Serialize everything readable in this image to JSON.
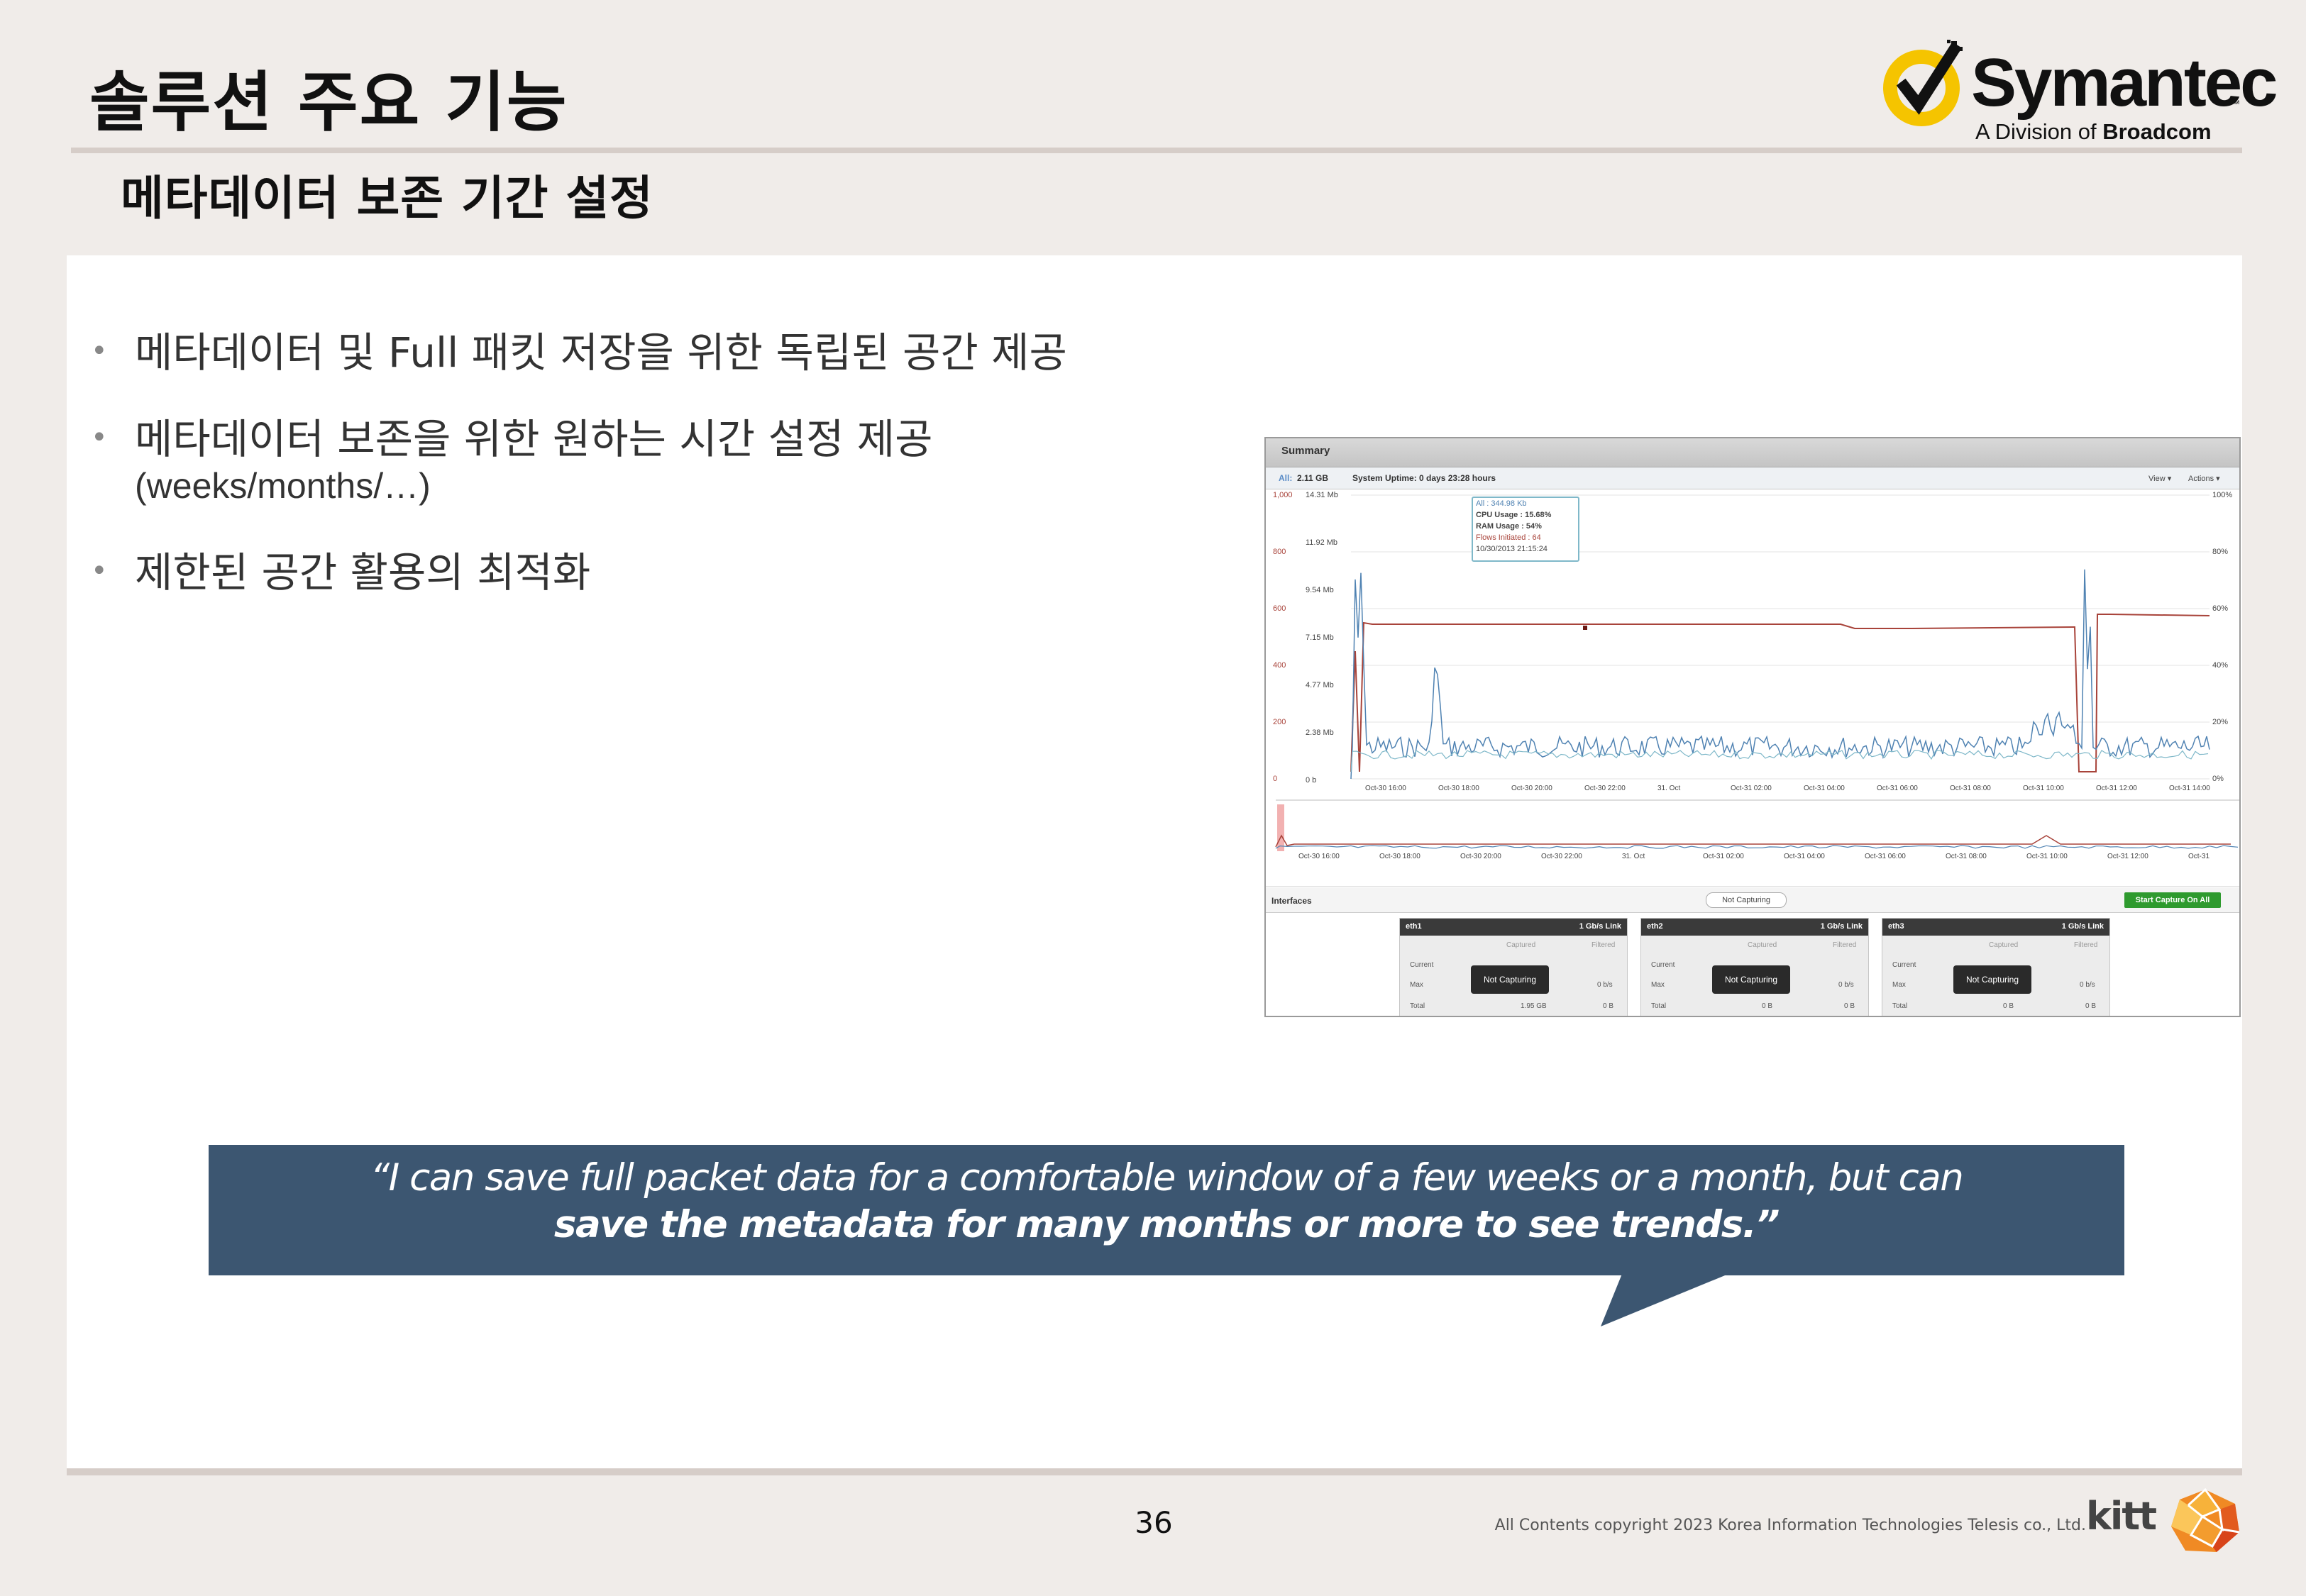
{
  "slide": {
    "title": "솔루션 주요 기능",
    "subtitle": "메타데이터 보존 기간 설정"
  },
  "logo": {
    "name": "Symantec",
    "tm": "™",
    "division_prefix": "A Division of ",
    "division_brand": "Broadcom",
    "colors": {
      "ring": "#f5c400",
      "check": "#111111"
    }
  },
  "bullets": [
    {
      "text": "메타데이터 및 Full 패킷 저장을 위한 독립된 공간 제공"
    },
    {
      "text": "메타데이터 보존을 위한 원하는 시간 설정 제공",
      "text2": "(weeks/months/…)"
    },
    {
      "text": "제한된 공간 활용의 최적화"
    }
  ],
  "screenshot": {
    "panel_title": "Summary",
    "all_label": "All:",
    "all_value": "2.11 GB",
    "uptime": "System Uptime: 0 days 23:28 hours",
    "view_menu": "View ▾",
    "actions_menu": "Actions ▾",
    "tooltip": {
      "all": "All : 344.98 Kb",
      "cpu": "CPU Usage : 15.68%",
      "ram": "RAM Usage : 54%",
      "flows": "Flows Initiated : 64",
      "time": "10/30/2013 21:15:24"
    },
    "left_axis_red": [
      "1,000",
      "800",
      "600",
      "400",
      "200",
      "0"
    ],
    "left_axis_blue": [
      "14.31 Mb",
      "11.92 Mb",
      "9.54 Mb",
      "7.15 Mb",
      "4.77 Mb",
      "2.38 Mb",
      "0 b"
    ],
    "right_axis": [
      "100%",
      "80%",
      "60%",
      "40%",
      "20%",
      "0%"
    ],
    "x_ticks": [
      "Oct-30 16:00",
      "Oct-30 18:00",
      "Oct-30 20:00",
      "Oct-30 22:00",
      "31. Oct",
      "Oct-31 02:00",
      "Oct-31 04:00",
      "Oct-31 06:00",
      "Oct-31 08:00",
      "Oct-31 10:00",
      "Oct-31 12:00",
      "Oct-31 14:00"
    ],
    "mini_x_ticks": [
      "Oct-30 16:00",
      "Oct-30 18:00",
      "Oct-30 20:00",
      "Oct-30 22:00",
      "31. Oct",
      "Oct-31 02:00",
      "Oct-31 04:00",
      "Oct-31 06:00",
      "Oct-31 08:00",
      "Oct-31 10:00",
      "Oct-31 12:00",
      "Oct-31"
    ],
    "interfaces_label": "Interfaces",
    "not_capturing_pill": "Not Capturing",
    "start_capture_button": "Start Capture On All",
    "colors": {
      "red_series": "#a8433a",
      "blue_series": "#4f82b2",
      "cyan_series": "#7fb8c9",
      "start_button": "#2e9a2e"
    },
    "interfaces": [
      {
        "name": "eth1",
        "link": "1 Gb/s Link",
        "captured": "Captured",
        "filtered": "Filtered",
        "current": "Current",
        "max": "Max",
        "total": "Total",
        "button": "Not Capturing",
        "max_val": "0 b/s",
        "total_cap": "1.95 GB",
        "total_filt": "0 B"
      },
      {
        "name": "eth2",
        "link": "1 Gb/s Link",
        "captured": "Captured",
        "filtered": "Filtered",
        "current": "Current",
        "max": "Max",
        "total": "Total",
        "button": "Not Capturing",
        "max_val": "0 b/s",
        "total_cap": "0 B",
        "total_filt": "0 B"
      },
      {
        "name": "eth3",
        "link": "1 Gb/s Link",
        "captured": "Captured",
        "filtered": "Filtered",
        "current": "Current",
        "max": "Max",
        "total": "Total",
        "button": "Not Capturing",
        "max_val": "0 b/s",
        "total_cap": "0 B",
        "total_filt": "0 B"
      }
    ]
  },
  "quote": {
    "line1": "“I can save full packet data for a comfortable window of a few weeks or a month, but can",
    "line2": "save the metadata for many months or more to see trends.”",
    "color": "#3c5671"
  },
  "footer": {
    "page_number": "36",
    "copyright": "All Contents copyright 2023 Korea Information Technologies Telesis co., Ltd.",
    "brand": "kitt"
  }
}
